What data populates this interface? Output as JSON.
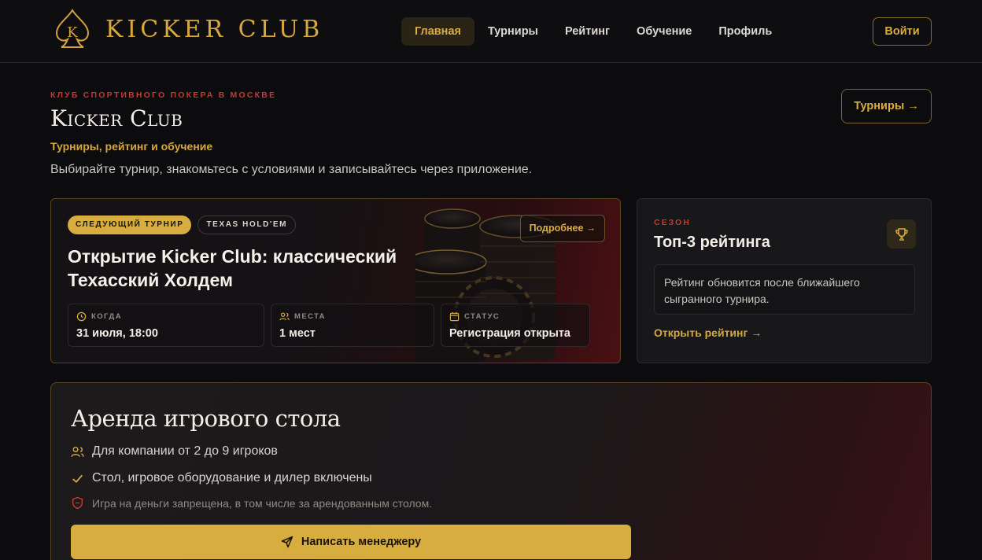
{
  "header": {
    "logo_text": "KICKER CLUB",
    "logo_letter": "K",
    "nav": [
      {
        "label": "Главная",
        "active": true
      },
      {
        "label": "Турниры",
        "active": false
      },
      {
        "label": "Рейтинг",
        "active": false
      },
      {
        "label": "Обучение",
        "active": false
      },
      {
        "label": "Профиль",
        "active": false
      }
    ],
    "login_label": "Войти"
  },
  "hero": {
    "eyebrow": "КЛУБ СПОРТИВНОГО ПОКЕРА В МОСКВЕ",
    "title": "Kicker Club",
    "subtitle": "Турниры, рейтинг и обучение",
    "description": "Выбирайте турнир, знакомьтесь с условиями и записывайтесь через приложение.",
    "tournaments_button": "Турниры →"
  },
  "tournament": {
    "badge_next": "СЛЕДУЮЩИЙ ТУРНИР",
    "badge_game": "TEXAS HOLD'EM",
    "more_button": "Подробнее →",
    "title": "Открытие Kicker Club: классический Техасский Холдем",
    "info": {
      "when_label": "КОГДА",
      "when_value": "31 июля, 18:00",
      "seats_label": "МЕСТА",
      "seats_value": "1 мест",
      "status_label": "СТАТУС",
      "status_value": "Регистрация открыта"
    }
  },
  "season": {
    "eyebrow": "СЕЗОН",
    "title": "Топ-3 рейтинга",
    "note": "Рейтинг обновится после ближайшего сыгранного турнира.",
    "link": "Открыть рейтинг →"
  },
  "rent": {
    "title": "Аренда игрового стола",
    "line1": "Для компании от 2 до 9 игроков",
    "line2": "Стол, игровое оборудование и дилер включены",
    "line3": "Игра на деньги запрещена, в том числе за арендованным столом.",
    "button": "Написать менеджеру"
  },
  "colors": {
    "accent_gold": "#d6ad3e",
    "eyebrow_red": "#c23a32",
    "background": "#0c0b0d"
  }
}
